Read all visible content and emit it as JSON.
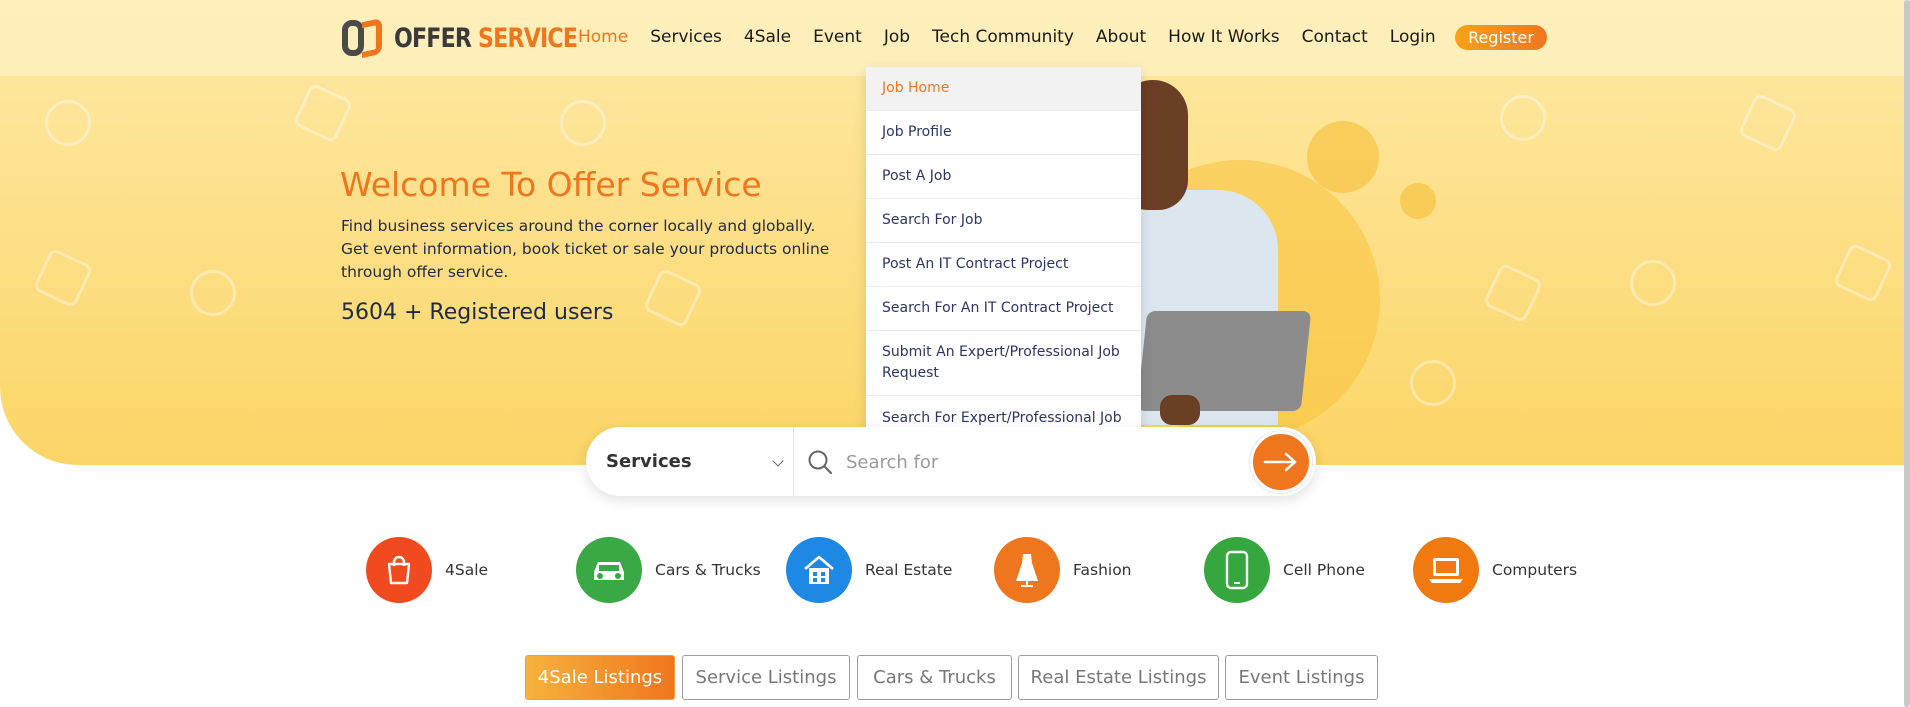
{
  "brand": {
    "part1": "OFFER",
    "part2": "SERVICE"
  },
  "nav": {
    "items": [
      {
        "label": "Home",
        "active": true
      },
      {
        "label": "Services"
      },
      {
        "label": "4Sale"
      },
      {
        "label": "Event"
      },
      {
        "label": "Job"
      },
      {
        "label": "Tech Community"
      },
      {
        "label": "About"
      },
      {
        "label": "How It Works"
      },
      {
        "label": "Contact"
      },
      {
        "label": "Login"
      }
    ],
    "register": "Register"
  },
  "hero": {
    "title": "Welcome To Offer Service",
    "description": "Find business services around the corner locally and globally. Get event information, book ticket or sale your products online through offer service.",
    "users": "5604 + Registered users"
  },
  "job_menu": [
    "Job Home",
    "Job Profile",
    "Post A Job",
    "Search For Job",
    "Post An IT Contract Project",
    "Search For An IT Contract Project",
    "Submit An Expert/Professional Job Request",
    "Search For Expert/Professional Job Request"
  ],
  "search": {
    "category": "Services",
    "placeholder": "Search for"
  },
  "categories": [
    {
      "label": "4Sale",
      "color": "#f04a1e",
      "icon": "shopping-bag-icon"
    },
    {
      "label": "Cars & Trucks",
      "color": "#3aa844",
      "icon": "car-icon"
    },
    {
      "label": "Real Estate",
      "color": "#1e88e5",
      "icon": "house-icon"
    },
    {
      "label": "Fashion",
      "color": "#f0761e",
      "icon": "dress-icon"
    },
    {
      "label": "Cell Phone",
      "color": "#36a63e",
      "icon": "phone-icon"
    },
    {
      "label": "Computers",
      "color": "#f07a10",
      "icon": "laptop-icon"
    }
  ],
  "tabs": [
    {
      "label": "4Sale Listings",
      "active": true
    },
    {
      "label": "Service Listings"
    },
    {
      "label": "Cars & Trucks"
    },
    {
      "label": "Real Estate Listings"
    },
    {
      "label": "Event Listings"
    }
  ],
  "colors": {
    "accent": "#f0761e",
    "hero": "#fde08a",
    "text": "#1f2a44"
  }
}
